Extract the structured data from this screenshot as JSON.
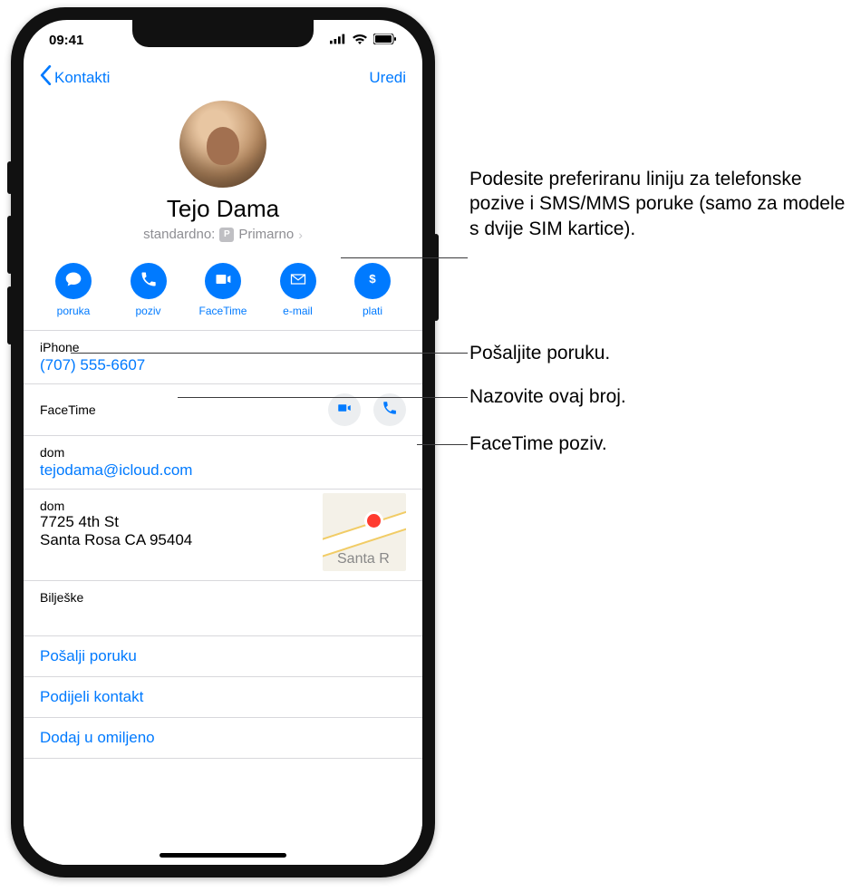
{
  "status": {
    "time": "09:41"
  },
  "nav": {
    "back": "Kontakti",
    "edit": "Uredi"
  },
  "contact": {
    "name": "Tejo Dama",
    "default_label": "standardno:",
    "default_badge": "P",
    "default_value": "Primarno"
  },
  "actions": {
    "message": "poruka",
    "call": "poziv",
    "facetime": "FaceTime",
    "email": "e-mail",
    "pay": "plati"
  },
  "phone": {
    "label": "iPhone",
    "number": "(707) 555-6607"
  },
  "facetime_label": "FaceTime",
  "email": {
    "label": "dom",
    "value": "tejodama@icloud.com"
  },
  "address": {
    "label": "dom",
    "line1": "7725 4th St",
    "line2": "Santa Rosa CA 95404",
    "map_label": "Santa R"
  },
  "notes_label": "Bilješke",
  "links": {
    "send_message": "Pošalji poruku",
    "share_contact": "Podijeli kontakt",
    "add_favorite": "Dodaj u omiljeno"
  },
  "callouts": {
    "c1": "Podesite preferiranu liniju za telefonske pozive i SMS/MMS poruke (samo za modele s dvije SIM kartice).",
    "c2": "Pošaljite poruku.",
    "c3": "Nazovite ovaj broj.",
    "c4": "FaceTime poziv."
  }
}
